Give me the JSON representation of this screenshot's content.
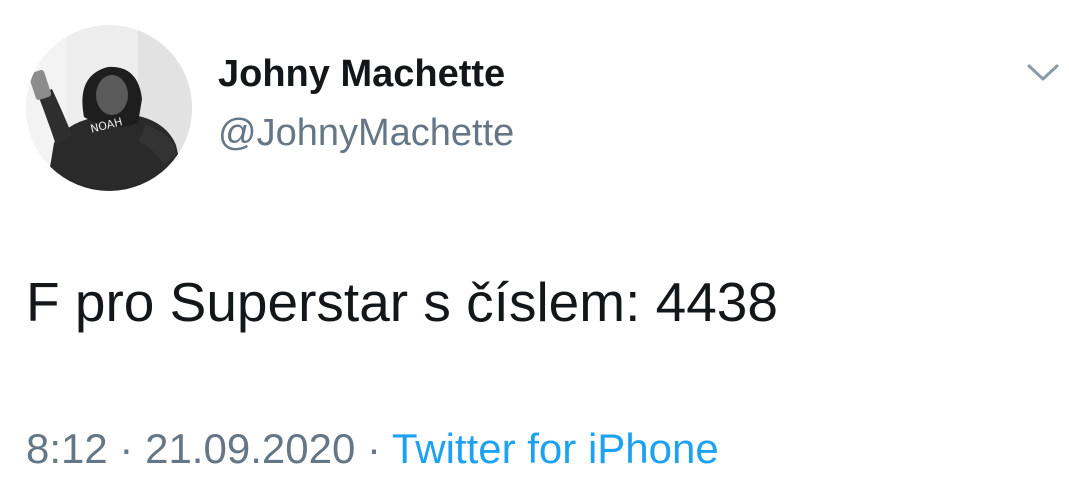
{
  "tweet": {
    "author": {
      "name": "Johny Machette",
      "handle": "@JohnyMachette",
      "avatar_icon": "user-avatar-photo",
      "hoodie_text": "NOAH"
    },
    "text": "F pro Superstar s číslem: 4438",
    "time": "8:12",
    "separator": "·",
    "date": "21.09.2020",
    "source": "Twitter for iPhone",
    "menu_icon": "chevron-down-icon"
  },
  "colors": {
    "text": "#14171a",
    "secondary": "#657786",
    "link": "#1da1f2"
  }
}
